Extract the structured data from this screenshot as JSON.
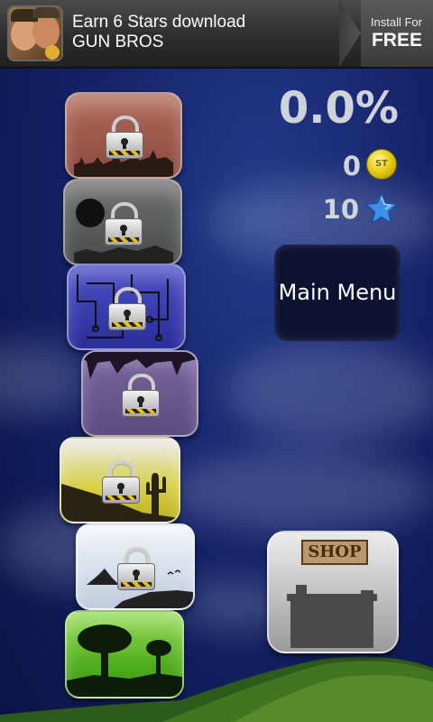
{
  "ad": {
    "headline": "Earn 6 Stars download",
    "app_name": "GUN BROS",
    "install_label": "Install For",
    "price_label": "FREE"
  },
  "progress": {
    "percent_text": "0.0%",
    "coins": "0",
    "coin_icon_text": "ST",
    "stars": "10"
  },
  "buttons": {
    "main_menu": "Main Menu",
    "shop_sign": "SHOP"
  },
  "levels": [
    {
      "id": "level-1",
      "theme": "wasteland",
      "locked": true,
      "color": "#a0584a"
    },
    {
      "id": "level-2",
      "theme": "moon-rocks",
      "locked": true,
      "color": "#5e5e5e"
    },
    {
      "id": "level-3",
      "theme": "circuit",
      "locked": true,
      "color": "#3a3fae"
    },
    {
      "id": "level-4",
      "theme": "cave",
      "locked": true,
      "color": "#6e5a92"
    },
    {
      "id": "level-5",
      "theme": "desert",
      "locked": true,
      "color": "#d8d040"
    },
    {
      "id": "level-6",
      "theme": "snow-peaks",
      "locked": true,
      "color": "#c8d4e8"
    },
    {
      "id": "level-7",
      "theme": "forest",
      "locked": false,
      "color": "#5ab828"
    }
  ]
}
